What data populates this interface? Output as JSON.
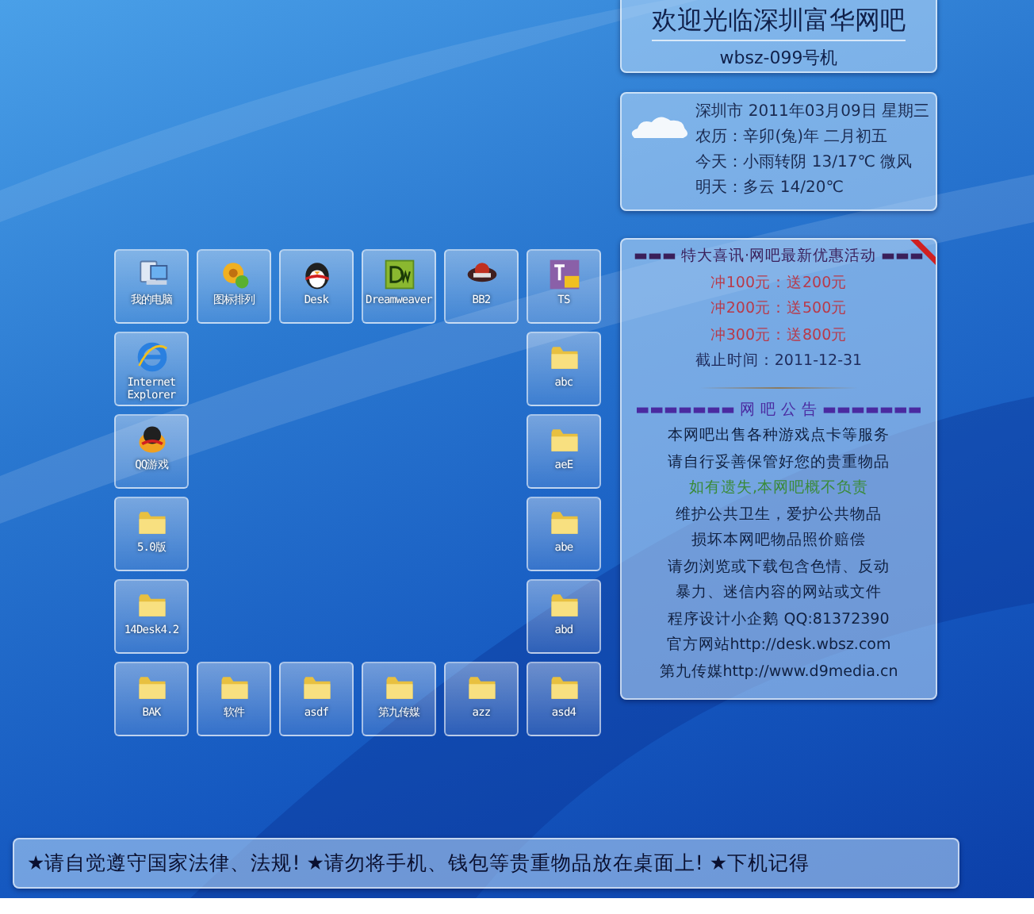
{
  "desktop": {
    "top_row": [
      {
        "label": "我的电脑",
        "kind": "computer"
      },
      {
        "label": "图标排列",
        "kind": "gear"
      },
      {
        "label": "Desk",
        "kind": "penguin"
      },
      {
        "label": "Dreamweaver",
        "kind": "dw"
      },
      {
        "label": "BB2",
        "kind": "game"
      },
      {
        "label": "TS",
        "kind": "ts"
      }
    ],
    "left_column": [
      {
        "label": "Internet Explorer",
        "kind": "ie"
      },
      {
        "label": "QQ游戏",
        "kind": "qq"
      },
      {
        "label": "5.0版",
        "kind": "folder"
      },
      {
        "label": "14Desk4.2",
        "kind": "folder"
      }
    ],
    "right_column": [
      {
        "label": "abc",
        "kind": "folder"
      },
      {
        "label": "aeE",
        "kind": "folder"
      },
      {
        "label": "abe",
        "kind": "folder"
      },
      {
        "label": "abd",
        "kind": "folder"
      }
    ],
    "bottom_row": [
      {
        "label": "BAK",
        "kind": "folder"
      },
      {
        "label": "软件",
        "kind": "folder"
      },
      {
        "label": "asdf",
        "kind": "folder"
      },
      {
        "label": "第九传媒",
        "kind": "folder"
      },
      {
        "label": "azz",
        "kind": "folder"
      },
      {
        "label": "asd4",
        "kind": "folder"
      }
    ]
  },
  "welcome": {
    "title": "欢迎光临深圳富华网吧",
    "machine": "wbsz-099号机"
  },
  "weather": {
    "lines": [
      "深圳市 2011年03月09日 星期三",
      "农历：辛卯(兔)年 二月初五",
      "今天：小雨转阴 13/17℃ 微风",
      "明天：多云 14/20℃"
    ]
  },
  "notice": {
    "promo_lines": [
      {
        "text": "▬▬▬ 特大喜讯·网吧最新优惠活动 ▬▬▬",
        "color": "#3a1f5a"
      },
      {
        "text": "冲100元：送200元",
        "color": "#b83a4a"
      },
      {
        "text": "冲200元：送500元",
        "color": "#b83a4a"
      },
      {
        "text": "冲300元：送800元",
        "color": "#b83a4a"
      },
      {
        "text": "截止时间：2011-12-31",
        "color": "#1e2a5a"
      }
    ],
    "notice_lines": [
      {
        "text": "▬▬▬▬▬▬▬ 网 吧 公 告 ▬▬▬▬▬▬▬",
        "color": "#4a2aa0"
      },
      {
        "text": "本网吧出售各种游戏点卡等服务",
        "color": "#102040"
      },
      {
        "text": "请自行妥善保管好您的贵重物品",
        "color": "#102040"
      },
      {
        "text": "如有遗失,本网吧概不负责",
        "color": "#3a8a3a"
      },
      {
        "text": "维护公共卫生，爱护公共物品",
        "color": "#102040"
      },
      {
        "text": "损坏本网吧物品照价赔偿",
        "color": "#102040"
      },
      {
        "text": "请勿浏览或下载包含色情、反动",
        "color": "#102040"
      },
      {
        "text": "暴力、迷信内容的网站或文件",
        "color": "#102040"
      },
      {
        "text": "程序设计小企鹅 QQ:81372390",
        "color": "#102040"
      },
      {
        "text": "官方网站http://desk.wbsz.com",
        "color": "#102040"
      },
      {
        "text": "第九传媒http://www.d9media.cn",
        "color": "#102040"
      }
    ]
  },
  "ticker": {
    "text": "★请自觉遵守国家法律、法规! ★请勿将手机、钱包等贵重物品放在桌面上! ★下机记得"
  }
}
